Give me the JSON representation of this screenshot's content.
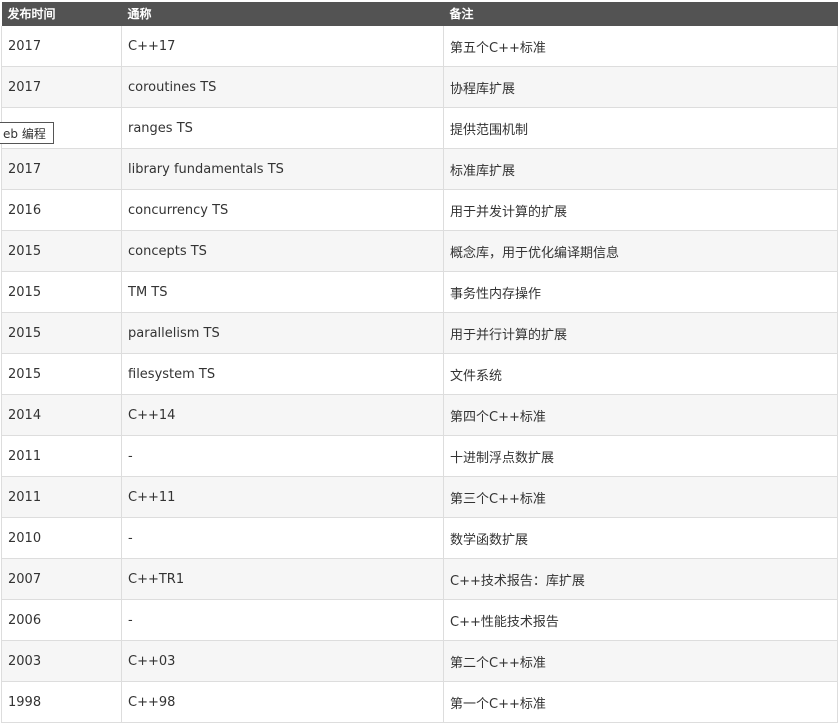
{
  "table": {
    "headers": [
      "发布时间",
      "通称",
      "备注"
    ],
    "rows": [
      {
        "date": "2017",
        "name": "C++17",
        "note": "第五个C++标准"
      },
      {
        "date": "2017",
        "name": "coroutines TS",
        "note": "协程库扩展"
      },
      {
        "date": "",
        "name": "ranges TS",
        "note": "提供范围机制"
      },
      {
        "date": "2017",
        "name": "library fundamentals TS",
        "note": "标准库扩展"
      },
      {
        "date": "2016",
        "name": "concurrency TS",
        "note": "用于并发计算的扩展"
      },
      {
        "date": "2015",
        "name": "concepts TS",
        "note": "概念库，用于优化编译期信息"
      },
      {
        "date": "2015",
        "name": "TM TS",
        "note": "事务性内存操作"
      },
      {
        "date": "2015",
        "name": "parallelism TS",
        "note": "用于并行计算的扩展"
      },
      {
        "date": "2015",
        "name": "filesystem TS",
        "note": "文件系统"
      },
      {
        "date": "2014",
        "name": "C++14",
        "note": "第四个C++标准"
      },
      {
        "date": "2011",
        "name": "-",
        "note": "十进制浮点数扩展"
      },
      {
        "date": "2011",
        "name": "C++11",
        "note": "第三个C++标准"
      },
      {
        "date": "2010",
        "name": "-",
        "note": "数学函数扩展"
      },
      {
        "date": "2007",
        "name": "C++TR1",
        "note": "C++技术报告：库扩展"
      },
      {
        "date": "2006",
        "name": "-",
        "note": "C++性能技术报告"
      },
      {
        "date": "2003",
        "name": "C++03",
        "note": "第二个C++标准"
      },
      {
        "date": "1998",
        "name": "C++98",
        "note": "第一个C++标准"
      }
    ]
  },
  "tooltip": {
    "text": "eb 编程"
  }
}
